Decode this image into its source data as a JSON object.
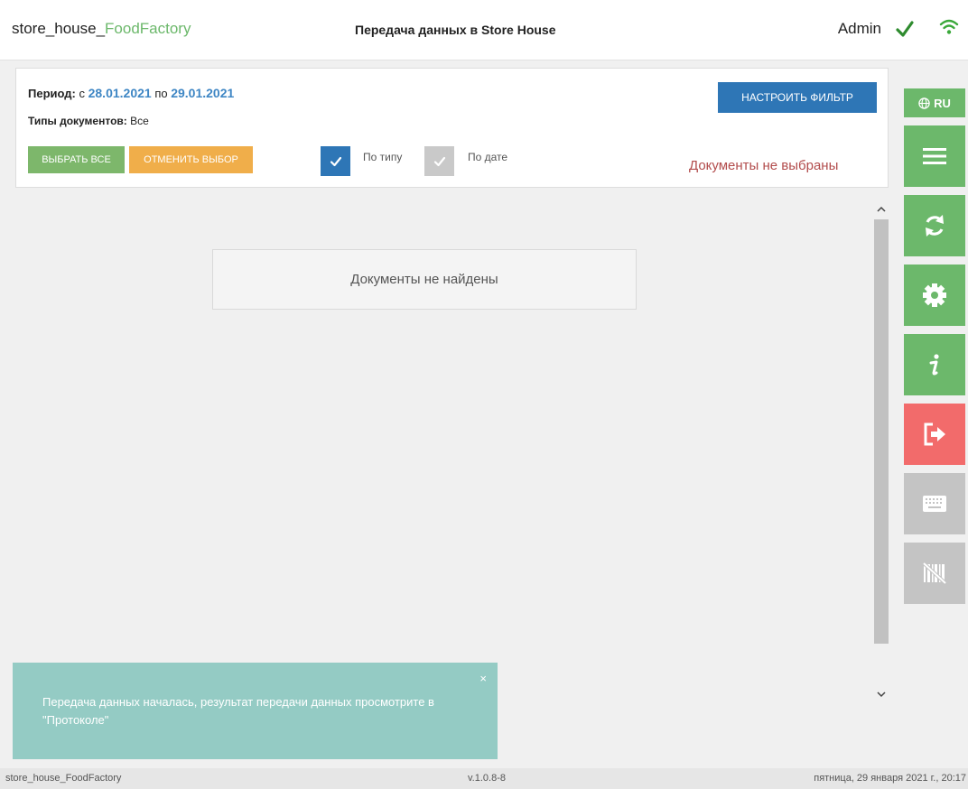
{
  "header": {
    "brand_prefix": "store_house_",
    "brand_accent": "FoodFactory",
    "title": "Передача данных в Store House",
    "user": "Admin",
    "status_icon": "checkmark-icon",
    "connection_icon": "wifi-icon"
  },
  "filter": {
    "period_label": "Период:",
    "from_word": "с",
    "date_from": "28.01.2021",
    "to_word": "по",
    "date_to": "29.01.2021",
    "doc_types_label": "Типы документов:",
    "doc_types_value": "Все",
    "select_all": "ВЫБРАТЬ ВСЕ",
    "cancel_selection": "ОТМЕНИТЬ ВЫБОР",
    "by_type_label": "По типу",
    "by_type_checked": true,
    "by_date_label": "По дате",
    "by_date_checked": false,
    "configure_filter": "НАСТРОИТЬ ФИЛЬТР",
    "no_docs_selected": "Документы не выбраны"
  },
  "main": {
    "empty_message": "Документы не найдены"
  },
  "sidebar": {
    "language": "RU",
    "items": [
      {
        "icon": "menu-icon",
        "color": "#6cb86b"
      },
      {
        "icon": "sync-icon",
        "color": "#6cb86b"
      },
      {
        "icon": "gear-icon",
        "color": "#6cb86b"
      },
      {
        "icon": "info-icon",
        "color": "#6cb86b"
      },
      {
        "icon": "logout-icon",
        "color": "#f26b6b"
      },
      {
        "icon": "keyboard-icon",
        "color": "#c4c4c4"
      },
      {
        "icon": "barcode-off-icon",
        "color": "#c4c4c4"
      }
    ]
  },
  "toast": {
    "message": "Передача данных началась, результат передачи данных просмотрите в \"Протоколе\"",
    "close": "×",
    "color": "#94cbc4"
  },
  "statusbar": {
    "app": "store_house_FoodFactory",
    "version": "v.1.0.8-8",
    "datetime": "пятница, 29 января 2021 г., 20:17"
  },
  "colors": {
    "accent_green": "#6cb86b",
    "accent_blue": "#2e76b6",
    "accent_orange": "#f0ae4a",
    "accent_red": "#f26b6b"
  }
}
